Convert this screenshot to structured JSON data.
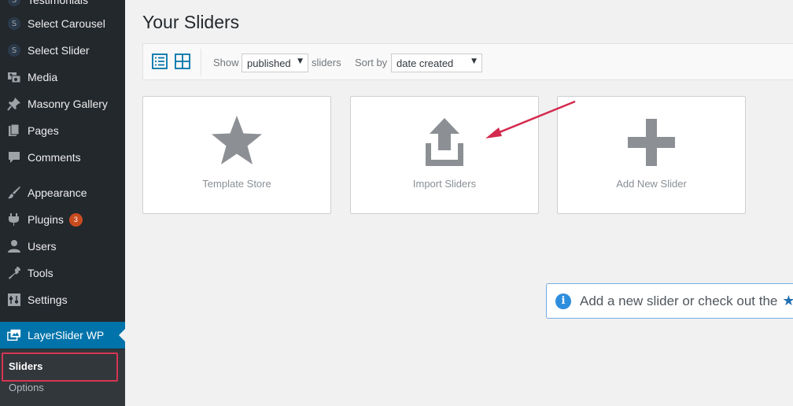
{
  "sidebar": {
    "items": [
      {
        "label": "Testimonials",
        "icon": "s-letter-icon"
      },
      {
        "label": "Select Carousel",
        "icon": "s-letter-icon"
      },
      {
        "label": "Select Slider",
        "icon": "s-letter-icon"
      },
      {
        "label": "Media",
        "icon": "media-icon"
      },
      {
        "label": "Masonry Gallery",
        "icon": "pin-icon"
      },
      {
        "label": "Pages",
        "icon": "pages-icon"
      },
      {
        "label": "Comments",
        "icon": "comments-icon"
      },
      {
        "label": "Appearance",
        "icon": "appearance-icon"
      },
      {
        "label": "Plugins",
        "icon": "plugins-icon",
        "badge": "3"
      },
      {
        "label": "Users",
        "icon": "users-icon"
      },
      {
        "label": "Tools",
        "icon": "tools-icon"
      },
      {
        "label": "Settings",
        "icon": "settings-icon"
      },
      {
        "label": "LayerSlider WP",
        "icon": "layerslider-icon",
        "current": true
      }
    ],
    "s_letter": "S",
    "submenu": [
      {
        "label": "Sliders",
        "active": true
      },
      {
        "label": "Options"
      }
    ]
  },
  "main": {
    "title": "Your Sliders",
    "toolbar": {
      "show_label": "Show",
      "filter_value": "published",
      "sliders_label": "sliders",
      "sort_label": "Sort by",
      "sort_value": "date created",
      "caret": "▼"
    },
    "cards": [
      {
        "label": "Template Store",
        "icon": "star-icon"
      },
      {
        "label": "Import Sliders",
        "icon": "upload-icon"
      },
      {
        "label": "Add New Slider",
        "icon": "plus-icon"
      }
    ],
    "notice": {
      "icon": "info-icon",
      "icon_text": "i",
      "text": "Add a new slider or check out the",
      "star": "★"
    }
  },
  "colors": {
    "sidebar_bg": "#23282d",
    "accent": "#0073aa",
    "highlight": "#d63650",
    "badge": "#ca4a1f",
    "annotation_arrow": "#d42a4e"
  }
}
